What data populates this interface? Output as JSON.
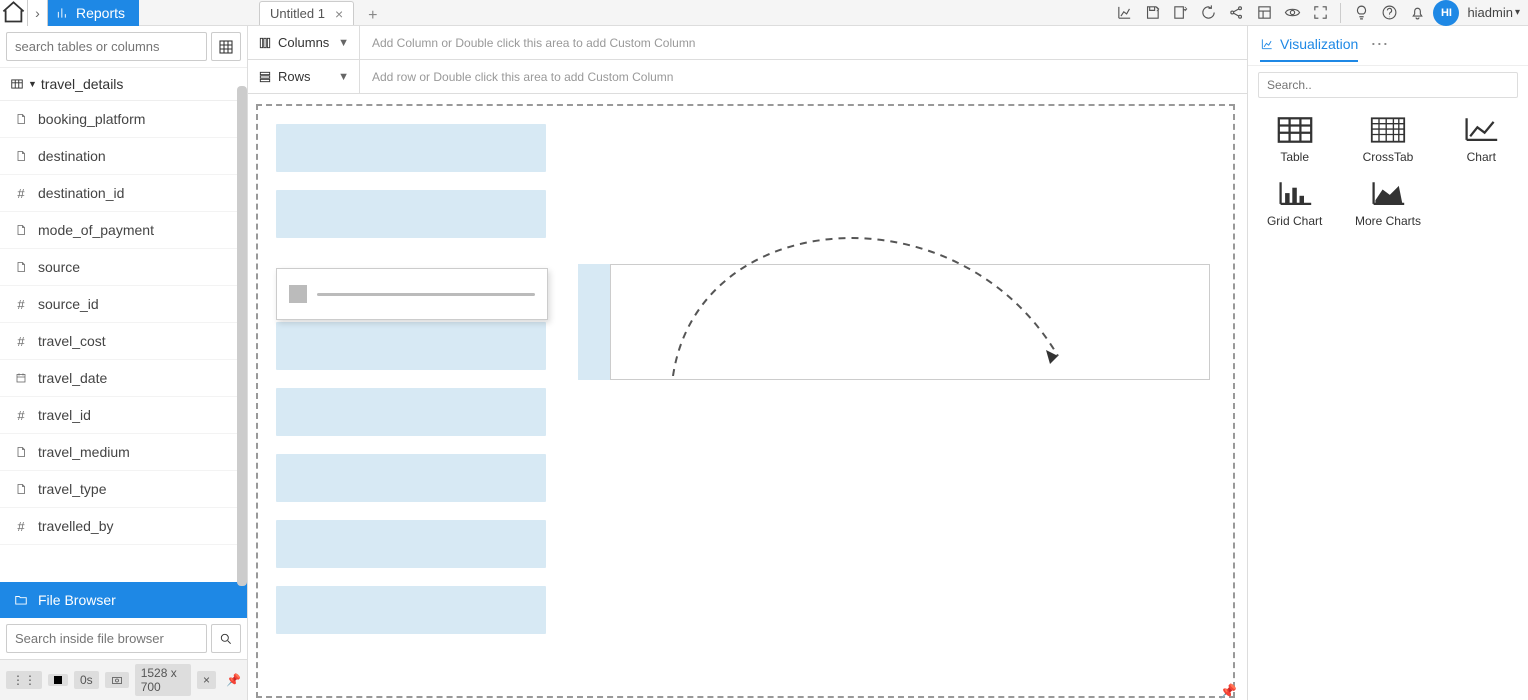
{
  "breadcrumb": {
    "reports_label": "Reports"
  },
  "tabs": {
    "active": "Untitled 1"
  },
  "user": {
    "initials": "HI",
    "name": "hiadmin"
  },
  "sidebar": {
    "search_placeholder": "search tables or columns",
    "table_name": "travel_details",
    "fields": [
      {
        "type": "text",
        "name": "booking_platform"
      },
      {
        "type": "text",
        "name": "destination"
      },
      {
        "type": "num",
        "name": "destination_id"
      },
      {
        "type": "text",
        "name": "mode_of_payment"
      },
      {
        "type": "text",
        "name": "source"
      },
      {
        "type": "num",
        "name": "source_id"
      },
      {
        "type": "num",
        "name": "travel_cost"
      },
      {
        "type": "date",
        "name": "travel_date"
      },
      {
        "type": "num",
        "name": "travel_id"
      },
      {
        "type": "text",
        "name": "travel_medium"
      },
      {
        "type": "text",
        "name": "travel_type"
      },
      {
        "type": "num",
        "name": "travelled_by"
      }
    ],
    "file_browser_label": "File Browser",
    "file_search_placeholder": "Search inside file browser"
  },
  "shelves": {
    "columns_label": "Columns",
    "columns_hint": "Add Column or Double click this area to add Custom Column",
    "rows_label": "Rows",
    "rows_hint": "Add row or Double click this area to add Custom Column"
  },
  "right": {
    "viz_tab_label": "Visualization",
    "search_placeholder": "Search..",
    "items": [
      "Table",
      "CrossTab",
      "Chart",
      "Grid Chart",
      "More Charts"
    ]
  },
  "status": {
    "time": "0s",
    "dims": "1528 x 700"
  }
}
